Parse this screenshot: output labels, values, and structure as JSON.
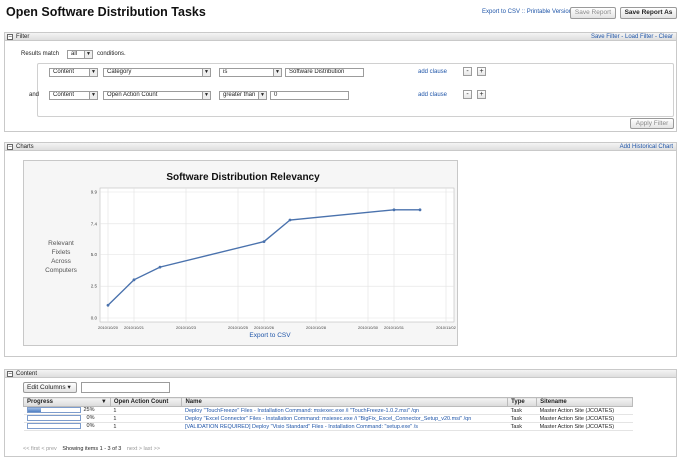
{
  "header": {
    "title": "Open Software Distribution Tasks",
    "export_csv": "Export to CSV",
    "separator": "::",
    "printable": "Printable Version",
    "separator2": "::",
    "save_report": "Save Report",
    "save_report_as": "Save Report As"
  },
  "filter": {
    "section_title": "Filter",
    "toggle": "−",
    "links": "Save Filter - Load Filter - Clear",
    "results_match": "Results match",
    "match_value": "all",
    "conditions": "conditions.",
    "and_label": "and",
    "clauses": [
      {
        "field": "Content",
        "property": "Category",
        "operator": "is",
        "value": "Software Distribution",
        "add": "add clause"
      },
      {
        "field": "Content",
        "property": "Open Action Count",
        "operator": "greater than",
        "value": "0",
        "add": "add clause"
      }
    ],
    "minus": "-",
    "plus": "+",
    "apply": "Apply Filter"
  },
  "charts": {
    "section_title": "Charts",
    "toggle": "−",
    "add_link": "Add Historical Chart",
    "export_link": "Export to CSV"
  },
  "chart_data": {
    "type": "line",
    "title": "Software Distribution Relevancy",
    "ylabel": "Relevant Fixlets Across Computers",
    "ylabel_lines": [
      "Relevant",
      "Fixlets",
      "Across",
      "Computers"
    ],
    "xlabel": "",
    "ylim": [
      0,
      9.9
    ],
    "yticks": [
      "0.0",
      "2.5",
      "5.0",
      "7.4",
      "9.9"
    ],
    "xticks": [
      "2010/10/20",
      "2010/10/21",
      "2010/10/23",
      "2010/10/25",
      "2010/10/26",
      "2010/10/28",
      "2010/10/30",
      "2010/10/31",
      "2010/11/02"
    ],
    "x": [
      "2010/10/20",
      "2010/10/21",
      "2010/10/22",
      "2010/10/26",
      "2010/10/27",
      "2010/10/31",
      "2010/11/01"
    ],
    "series": [
      {
        "values": [
          1.0,
          3.0,
          4.0,
          6.0,
          7.7,
          8.5,
          8.5
        ],
        "color": "#4a72ad"
      }
    ],
    "grid": true,
    "legend": "none"
  },
  "content": {
    "section_title": "Content",
    "toggle": "−",
    "edit_columns": "Edit Columns",
    "search_placeholder": "",
    "columns": [
      "Progress",
      "Open Action Count",
      "Name",
      "Type",
      "Sitename"
    ],
    "rows": [
      {
        "progress": 25,
        "progress_label": "25%",
        "count": "1",
        "name": "Deploy \"TouchFreeze\" Files - Installation Command: msiexec.exe /i \"TouchFreeze-1.0.2.msi\" /qn",
        "type": "Task",
        "site": "Master Action Site (JCOATES)"
      },
      {
        "progress": 0,
        "progress_label": "0%",
        "count": "1",
        "name": "Deploy \"Excel Connector\" Files - Installation Command: msiexec.exe /i \"BigFix_Excel_Connector_Setup_v20.msi\" /qn",
        "type": "Task",
        "site": "Master Action Site (JCOATES)"
      },
      {
        "progress": 0,
        "progress_label": "0%",
        "count": "1",
        "name": "[VALIDATION REQUIRED] Deploy \"Visio Standard\" Files - Installation Command: \"setup.exe\" /s",
        "type": "Task",
        "site": "Master Action Site (JCOATES)"
      }
    ],
    "pager_prev": "<< first < prev",
    "pager_status": "Showing items 1 - 3 of 3",
    "pager_next": "next > last >>"
  }
}
